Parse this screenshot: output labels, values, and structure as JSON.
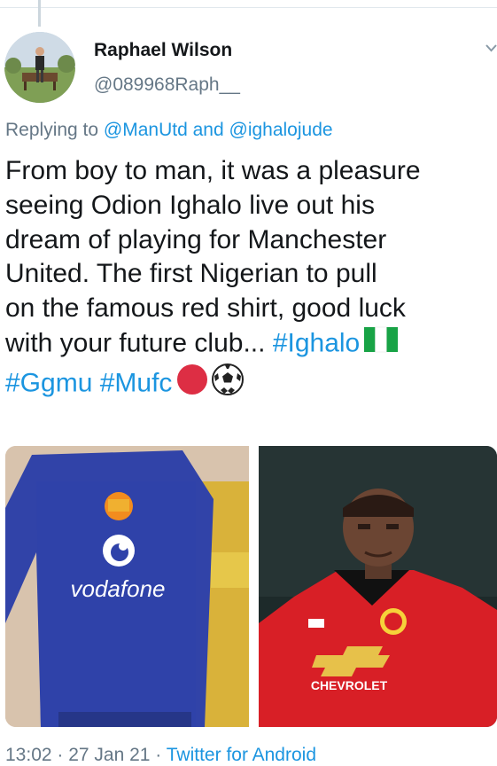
{
  "tweet": {
    "author_name": "Raphael Wilson",
    "author_handle": "@089968Raph__",
    "reply": {
      "prefix": "Replying to",
      "mention_1": "@ManUtd",
      "conjunction": "and",
      "mention_2": "@ighalojude"
    },
    "text_lines": [
      "From boy to man, it was a pleasure",
      "seeing Odion Ighalo live out his",
      "dream of playing for Manchester",
      "United. The first Nigerian to pull",
      "on the famous red shirt, good luck",
      "with your future club... "
    ],
    "hashtags": [
      "#Ighalo",
      "#Ggmu",
      "#Mufc"
    ],
    "emojis": [
      "nigeria-flag-icon",
      "red-circle-icon",
      "soccer-ball-icon"
    ],
    "media": [
      {
        "name": "boy-in-vodafone-jersey-photo",
        "shirt_text": "vodafone"
      },
      {
        "name": "ighalo-man-utd-photo",
        "shirt_text": "CHEVROLET"
      }
    ],
    "timestamp": "13:02 · 27 Jan 21 ·",
    "source": "Twitter for Android"
  },
  "colors": {
    "link": "#1b95e0",
    "secondary_text": "#657786",
    "primary_text": "#14171a",
    "utd_red": "#e61e2b",
    "vodafone_shirt": "#2f43a8"
  }
}
